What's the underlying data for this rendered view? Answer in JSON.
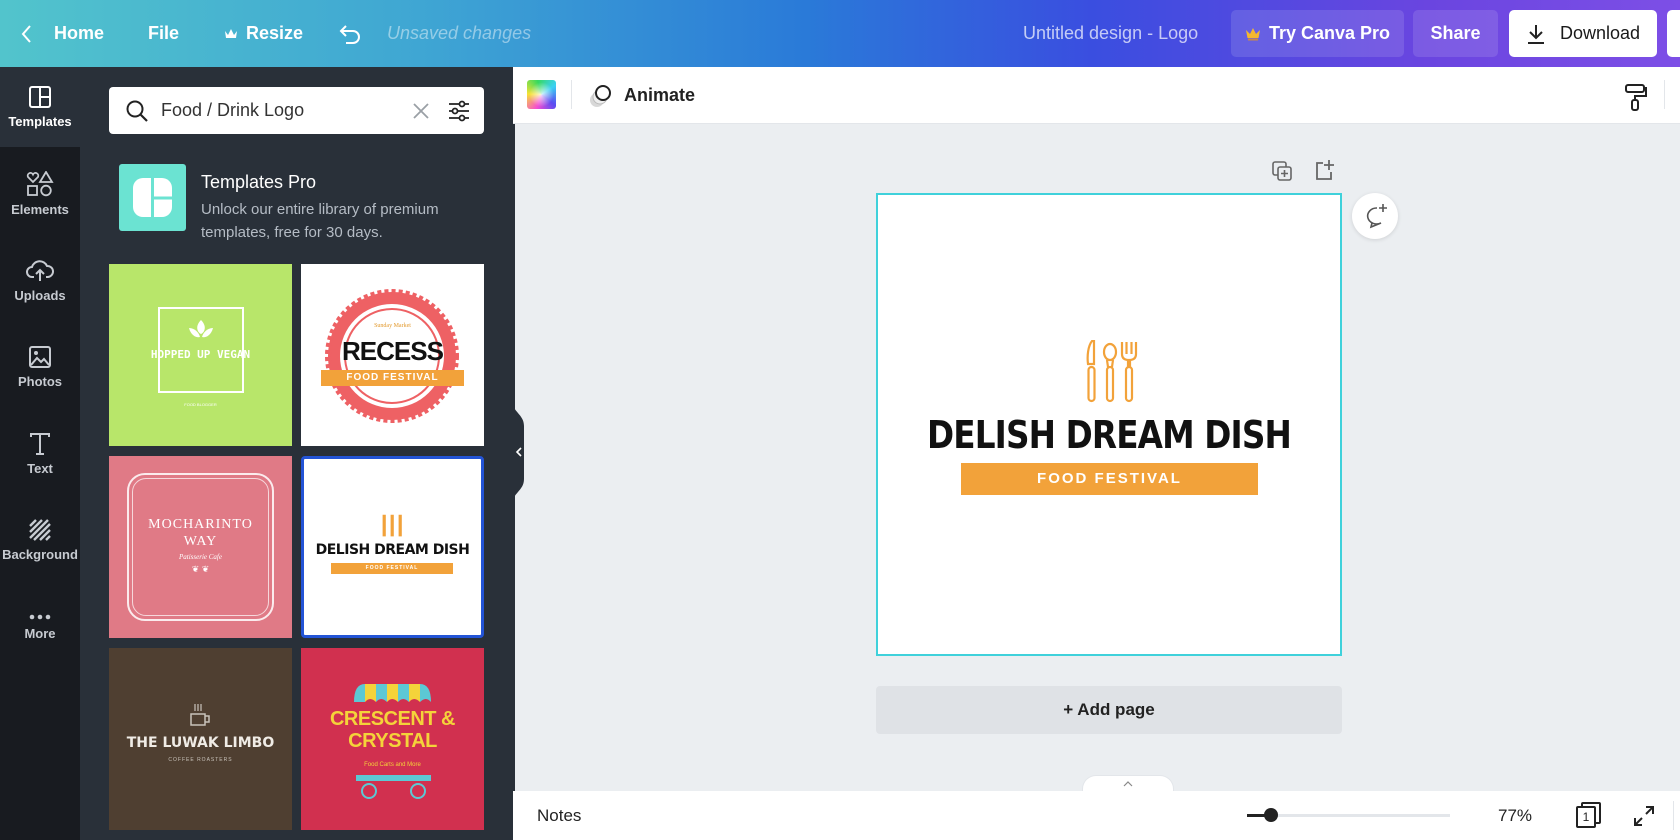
{
  "topbar": {
    "home_label": "Home",
    "file_label": "File",
    "resize_label": "Resize",
    "status": "Unsaved changes",
    "design_title": "Untitled design - Logo",
    "try_pro_label": "Try Canva Pro",
    "share_label": "Share",
    "download_label": "Download"
  },
  "rail": {
    "items": [
      {
        "label": "Templates",
        "icon": "templates-icon",
        "active": true
      },
      {
        "label": "Elements",
        "icon": "elements-icon"
      },
      {
        "label": "Uploads",
        "icon": "upload-cloud-icon"
      },
      {
        "label": "Photos",
        "icon": "photo-icon"
      },
      {
        "label": "Text",
        "icon": "text-icon"
      },
      {
        "label": "Background",
        "icon": "background-icon"
      },
      {
        "label": "More",
        "icon": "more-icon"
      }
    ]
  },
  "panel": {
    "search": {
      "value": "Food / Drink Logo"
    },
    "pro_card": {
      "title": "Templates Pro",
      "description": "Unlock our entire library of premium templates, free for 30 days."
    },
    "templates": [
      {
        "name": "HOPPED UP VEGAN",
        "subtitle": "FOOD BLOGGER",
        "bg": "#b8e66a"
      },
      {
        "name": "RECESS",
        "top": "Sunday Market",
        "subtitle": "FOOD FESTIVAL",
        "bg": "#ffffff"
      },
      {
        "name": "MOCHARINTO WAY",
        "subtitle": "Patisserie Cafe",
        "bg": "#e07a86"
      },
      {
        "name": "DELISH DREAM DISH",
        "subtitle": "FOOD FESTIVAL",
        "bg": "#ffffff",
        "selected": true
      },
      {
        "name": "THE LUWAK LIMBO",
        "subtitle": "COFFEE ROASTERS",
        "bg": "#4f3f31"
      },
      {
        "name": "CRESCENT & CRYSTAL",
        "subtitle": "Food Carts and More",
        "bg": "#d1304f"
      }
    ]
  },
  "toolbar": {
    "animate_label": "Animate"
  },
  "canvas": {
    "headline": "DELISH DREAM DISH",
    "banner": "FOOD FESTIVAL",
    "accent": "#f2a23a",
    "border_color": "#3fd1db"
  },
  "add_page_label": "+ Add page",
  "bottombar": {
    "notes_label": "Notes",
    "zoom_value": "77%",
    "zoom_fraction": 0.12,
    "page_count": "1"
  }
}
